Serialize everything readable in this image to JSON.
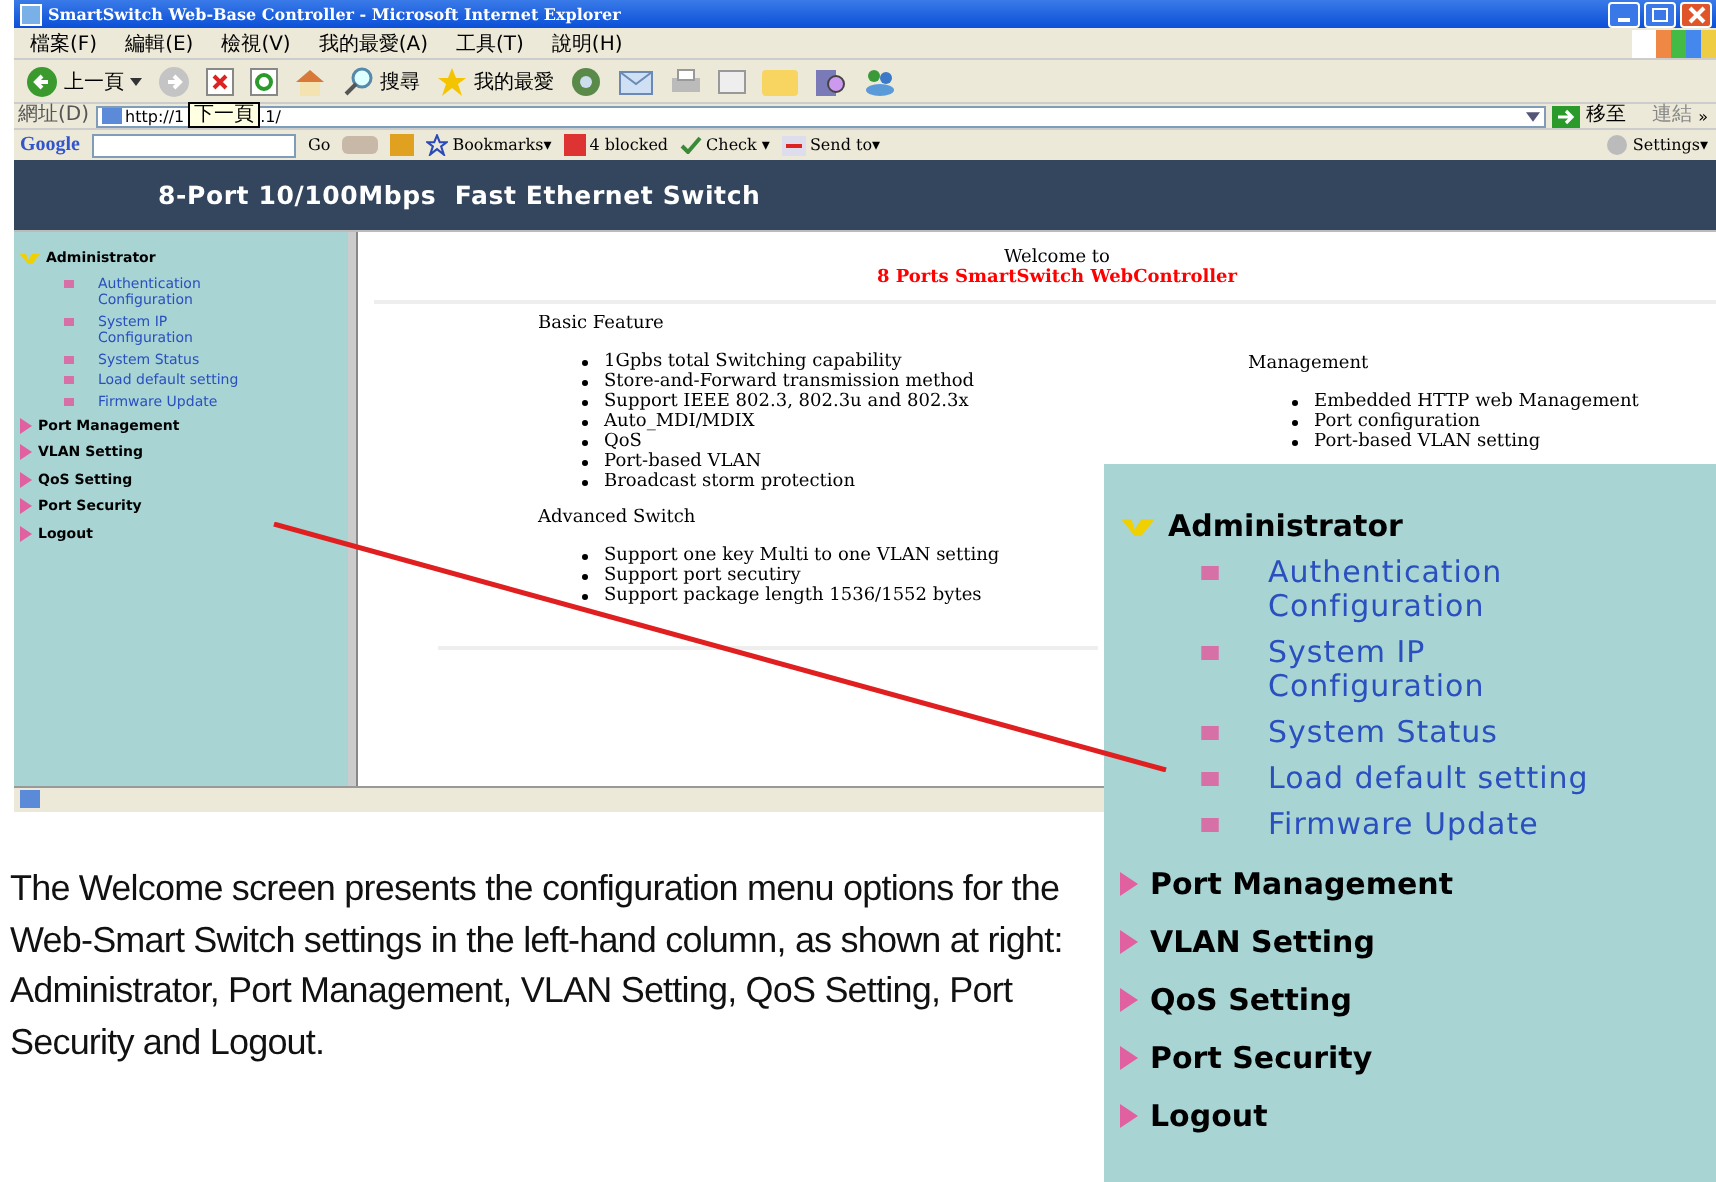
{
  "window": {
    "title": "SmartSwitch Web-Base Controller - Microsoft Internet Explorer"
  },
  "menu": [
    "檔案(F)",
    "編輯(E)",
    "檢視(V)",
    "我的最愛(A)",
    "工具(T)",
    "說明(H)"
  ],
  "toolbar": {
    "back": "上一頁",
    "search": "搜尋",
    "favorites": "我的最愛"
  },
  "address_bar": {
    "label": "網址(D)",
    "value_start": "http://1",
    "tooltip": "下一頁",
    "value_end": ".1/",
    "go": "移至",
    "links": "連結",
    "more": "»"
  },
  "google_bar": {
    "logo": "Google",
    "go": "Go",
    "bookmarks": "Bookmarks▾",
    "blocked": "4 blocked",
    "check": "Check ▾",
    "send": "Send to▾",
    "settings": "Settings▾"
  },
  "page": {
    "header": "8-Port 10/100Mbps  Fast Ethernet Switch",
    "sidebar": [
      {
        "label": "Administrator",
        "expanded": true,
        "children": [
          "Authentication Configuration",
          "System IP Configuration",
          "System Status",
          "Load default setting",
          "Firmware Update"
        ]
      },
      {
        "label": "Port Management",
        "expanded": false
      },
      {
        "label": "VLAN Setting",
        "expanded": false
      },
      {
        "label": "QoS Setting",
        "expanded": false
      },
      {
        "label": "Port Security",
        "expanded": false
      },
      {
        "label": "Logout",
        "expanded": false
      }
    ],
    "welcome": "Welcome to",
    "product": "8 Ports SmartSwitch WebController",
    "sections": [
      {
        "title": "Basic Feature",
        "items": [
          "1Gpbs total Switching capability",
          "Store-and-Forward transmission method",
          "Support IEEE 802.3, 802.3u and 802.3x",
          "Auto_MDI/MDIX",
          "QoS",
          "Port-based VLAN",
          "Broadcast storm protection"
        ]
      },
      {
        "title": "Advanced Switch",
        "items": [
          "Support one key Multi to one VLAN setting",
          "Support port secutiry",
          "Support package length 1536/1552 bytes"
        ]
      }
    ],
    "management": {
      "title": "Management",
      "items": [
        "Embedded HTTP web Management",
        "Port configuration",
        "Port-based VLAN setting"
      ]
    }
  },
  "caption": "The Welcome screen presents the configuration menu options for the Web-Smart Switch settings in the left-hand column, as shown at right: Administrator, Port Management, VLAN Setting, QoS Setting, Port Security and Logout.",
  "inset": {
    "sidebar": [
      {
        "label": "Administrator",
        "expanded": true,
        "children": [
          "Authentication Configuration",
          "System IP Configuration",
          "System Status",
          "Load default setting",
          "Firmware Update"
        ]
      },
      {
        "label": "Port Management",
        "expanded": false
      },
      {
        "label": "VLAN Setting",
        "expanded": false
      },
      {
        "label": "QoS Setting",
        "expanded": false
      },
      {
        "label": "Port Security",
        "expanded": false
      },
      {
        "label": "Logout",
        "expanded": false
      }
    ]
  }
}
